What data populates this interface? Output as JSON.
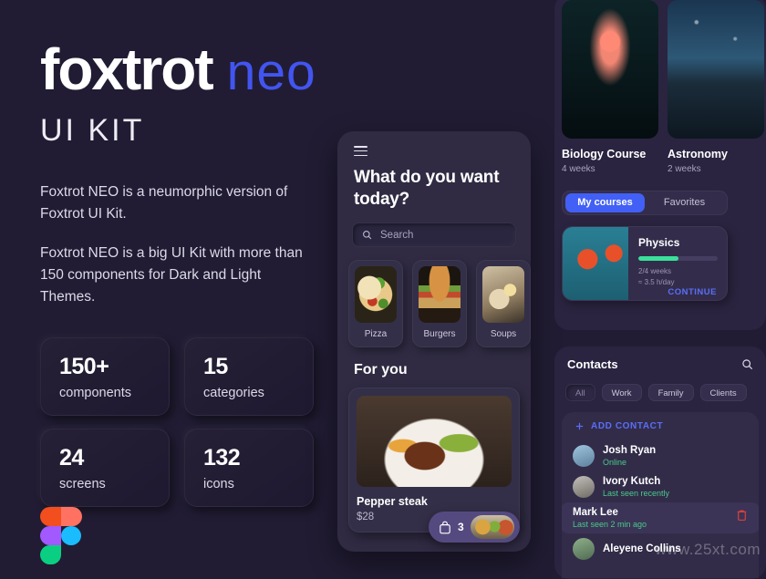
{
  "hero": {
    "logo_bold": "foxtrot",
    "logo_light": "neo",
    "subtitle": "UI KIT",
    "paragraph1": "Foxtrot NEO is a neumorphic version of Foxtrot UI Kit.",
    "paragraph2": "Foxtrot NEO is a big UI Kit with more than 150 components for Dark and Light Themes.",
    "stats": [
      {
        "value": "150+",
        "label": "components"
      },
      {
        "value": "15",
        "label": "categories"
      },
      {
        "value": "24",
        "label": "screens"
      },
      {
        "value": "132",
        "label": "icons"
      }
    ]
  },
  "food_app": {
    "heading": "What do you want today?",
    "search_placeholder": "Search",
    "categories": [
      {
        "name": "Pizza"
      },
      {
        "name": "Burgers"
      },
      {
        "name": "Soups"
      }
    ],
    "section_title": "For you",
    "dish": {
      "name": "Pepper steak",
      "price": "$28"
    },
    "cart_count": "3"
  },
  "courses": {
    "cards": [
      {
        "title": "Biology Course",
        "duration": "4 weeks"
      },
      {
        "title": "Astronomy",
        "duration": "2 weeks"
      }
    ],
    "tabs": [
      {
        "label": "My courses",
        "active": true
      },
      {
        "label": "Favorites",
        "active": false
      }
    ],
    "current": {
      "title": "Physics",
      "progress_pct": 50,
      "weeks": "2/4 weeks",
      "pace": "≈ 3.5 h/day",
      "action": "CONTINUE"
    }
  },
  "contacts": {
    "title": "Contacts",
    "filters": [
      {
        "label": "All",
        "active": false
      },
      {
        "label": "Work",
        "active": true
      },
      {
        "label": "Family",
        "active": true
      },
      {
        "label": "Clients",
        "active": true
      }
    ],
    "add_label": "ADD CONTACT",
    "people": [
      {
        "name": "Josh Ryan",
        "status": "Online"
      },
      {
        "name": "Ivory Kutch",
        "status": "Last seen recently"
      },
      {
        "name": "Mark Lee",
        "status": "Last seen 2 min ago"
      },
      {
        "name": "Aleyene Collins",
        "status": ""
      }
    ]
  },
  "watermark": "www.25xt.com",
  "colors": {
    "background": "#211c33",
    "panel": "#2a2440",
    "phone": "#302b43",
    "accent_blue": "#4255f0",
    "accent_progress": "#3be09b",
    "status_green": "#4bc98a",
    "delete_red": "#e8413c"
  }
}
